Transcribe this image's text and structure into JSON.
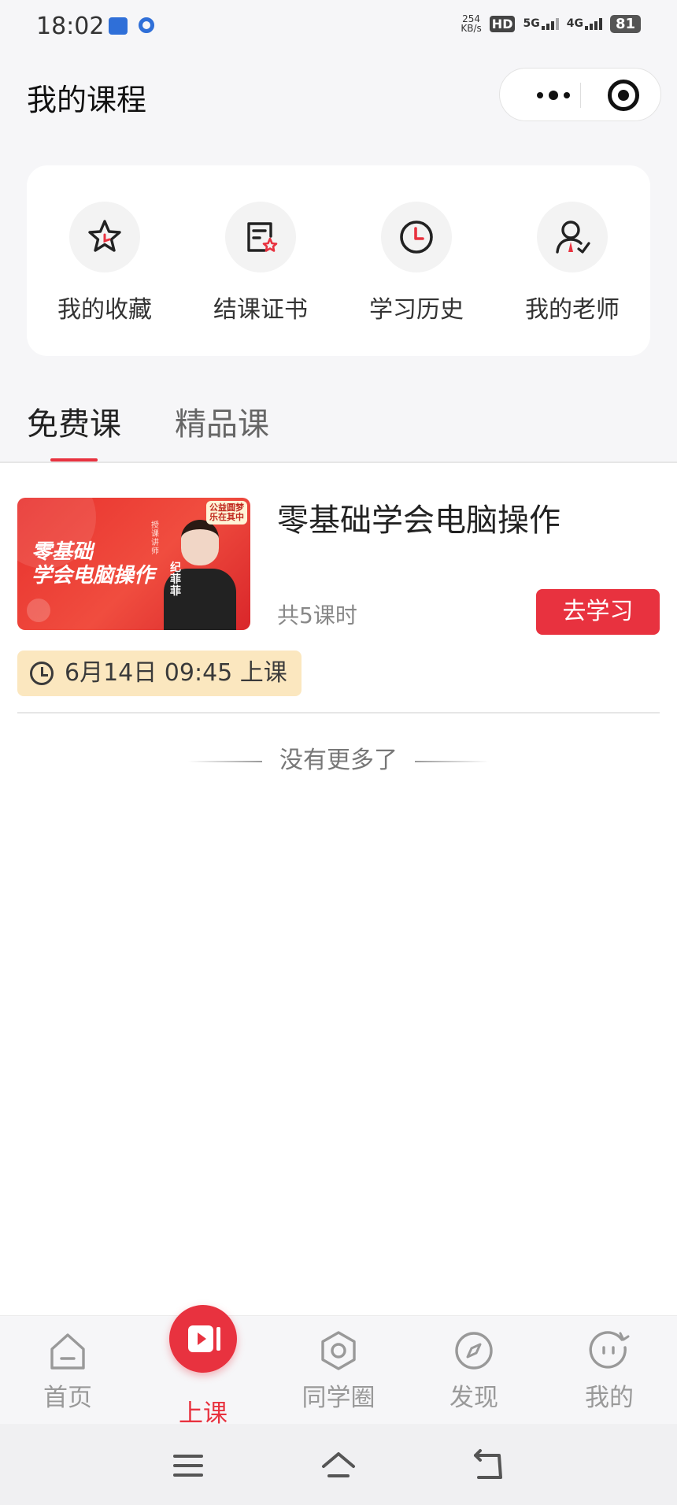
{
  "status_bar": {
    "time": "18:02",
    "net_speed_value": "254",
    "net_speed_unit": "KB/s",
    "hd_badge": "HD",
    "sim1_network": "5G",
    "sim2_network": "4G",
    "battery": "81"
  },
  "header": {
    "title": "我的课程"
  },
  "shortcuts": [
    {
      "label": "我的收藏",
      "icon": "star-icon"
    },
    {
      "label": "结课证书",
      "icon": "certificate-icon"
    },
    {
      "label": "学习历史",
      "icon": "clock-history-icon"
    },
    {
      "label": "我的老师",
      "icon": "teacher-icon"
    }
  ],
  "tabs": {
    "free": "免费课",
    "premium": "精品课",
    "active": "free"
  },
  "course": {
    "title": "零基础学会电脑操作",
    "lesson_count": "共5课时",
    "button": "去学习",
    "schedule": "6月14日 09:45 上课",
    "cover": {
      "title_line1": "零基础",
      "title_line2": "学会电脑操作",
      "tag_line1": "公益圆梦",
      "tag_line2": "乐在其中",
      "teacher_caption": "授课讲师",
      "teacher_name": "纪菲菲"
    }
  },
  "list_end": "没有更多了",
  "bottom_nav": [
    {
      "label": "首页",
      "icon": "home-icon"
    },
    {
      "label": "上课",
      "icon": "play-class-icon",
      "active": true
    },
    {
      "label": "同学圈",
      "icon": "hexagon-icon"
    },
    {
      "label": "发现",
      "icon": "compass-icon"
    },
    {
      "label": "我的",
      "icon": "face-icon"
    }
  ],
  "colors": {
    "accent": "#e8323f",
    "schedule_bg": "#fbe7bf",
    "page_bg": "#f6f6f8"
  }
}
